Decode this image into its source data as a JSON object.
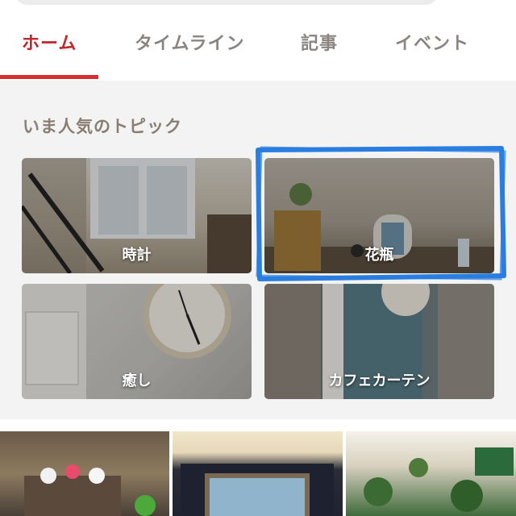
{
  "tabs": [
    {
      "label": "ホーム",
      "active": true
    },
    {
      "label": "タイムライン",
      "active": false
    },
    {
      "label": "記事",
      "active": false
    },
    {
      "label": "イベント",
      "active": false
    }
  ],
  "topics": {
    "title": "いま人気のトピック",
    "cards": [
      {
        "label": "時計"
      },
      {
        "label": "花瓶",
        "highlighted": true
      },
      {
        "label": "癒し"
      },
      {
        "label": "カフェカーテン"
      }
    ]
  },
  "colors": {
    "accent": "#d62d2f",
    "highlight_scribble": "#2a7ee0"
  }
}
